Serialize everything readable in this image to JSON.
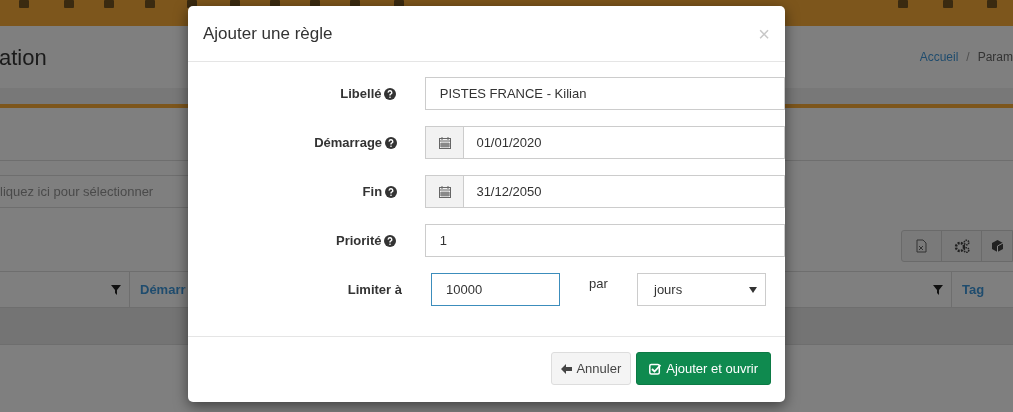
{
  "page": {
    "title": "ation",
    "breadcrumb": [
      "Accueil",
      "Param"
    ],
    "breadcrumb_separator": "/",
    "selector": {
      "placeholder": "liquez ici pour sélectionner"
    },
    "table": {
      "columns": [
        "",
        "Démarr",
        "",
        "Tag"
      ]
    }
  },
  "modal": {
    "title": "Ajouter une règle",
    "close": "×",
    "fields": [
      {
        "kind": "text",
        "label": "Libellé",
        "help": true,
        "value": "PISTES FRANCE - Kilian"
      },
      {
        "kind": "date",
        "label": "Démarrage",
        "help": true,
        "value": "01/01/2020"
      },
      {
        "kind": "date",
        "label": "Fin",
        "help": true,
        "value": "31/12/2050"
      },
      {
        "kind": "text",
        "label": "Priorité",
        "help": true,
        "value": "1"
      },
      {
        "kind": "limit",
        "label": "Limiter à",
        "help": false,
        "value": "10000",
        "focused": true,
        "per_label": "par",
        "unit": "jours"
      }
    ],
    "buttons": [
      {
        "kind": "cancel",
        "label": "Annuler"
      },
      {
        "kind": "primary",
        "label": "Ajouter et ouvrir"
      }
    ]
  }
}
